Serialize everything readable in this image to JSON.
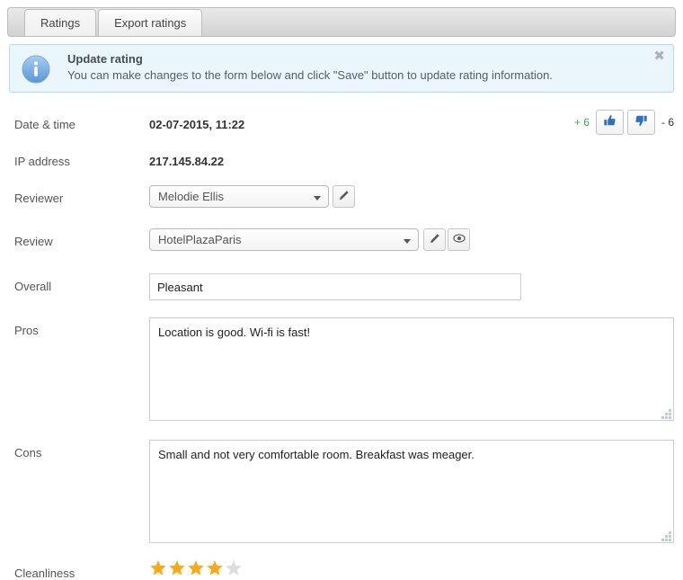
{
  "tabs": [
    {
      "label": "Ratings",
      "active": true
    },
    {
      "label": "Export ratings",
      "active": false
    }
  ],
  "banner": {
    "icon": "info-icon",
    "title": "Update rating",
    "text": "You can make changes to the form below and click \"Save\" button to update rating information.",
    "close_label": "✖",
    "bg_color": "#eaf6fb",
    "border_color": "#b3dced"
  },
  "votes": {
    "plus_label": "+ 6",
    "plus_color": "#4aa564",
    "minus_label": "- 6",
    "minus_color": "#333333",
    "thumb_up_icon": "thumbs-up-icon",
    "thumb_down_icon": "thumbs-down-icon",
    "icon_color": "#2f6fbd"
  },
  "form": {
    "datetime": {
      "label": "Date & time",
      "value": "02-07-2015, 11:22"
    },
    "ip": {
      "label": "IP address",
      "value": "217.145.84.22"
    },
    "reviewer": {
      "label": "Reviewer",
      "value": "Melodie Ellis",
      "edit_icon": "pencil-icon"
    },
    "review": {
      "label": "Review",
      "value": "HotelPlazaParis",
      "edit_icon": "pencil-icon",
      "view_icon": "eye-icon"
    },
    "overall": {
      "label": "Overall",
      "value": "Pleasant",
      "placeholder": ""
    },
    "pros": {
      "label": "Pros",
      "value": "Location is good. Wi-fi is fast!",
      "placeholder": ""
    },
    "cons": {
      "label": "Cons",
      "value": "Small and not very comfortable room. Breakfast was meager.",
      "placeholder": ""
    },
    "cleanliness": {
      "label": "Cleanliness",
      "rating": 4,
      "max": 5,
      "star_on_color": "#fba919",
      "star_off_color": "#dddddd"
    }
  }
}
